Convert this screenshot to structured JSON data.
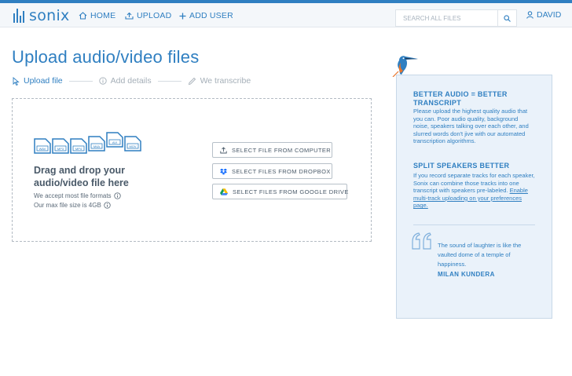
{
  "brand": {
    "logo_text": "sonix",
    "color": "#2f7fc1"
  },
  "nav": {
    "home": "HOME",
    "upload": "UPLOAD",
    "add_user": "ADD USER",
    "search_placeholder": "SEARCH ALL FILES",
    "user": "DAVID"
  },
  "page": {
    "title": "Upload audio/video files"
  },
  "steps": [
    {
      "label": "Upload file",
      "icon": "cursor-icon",
      "active": true
    },
    {
      "label": "Add details",
      "icon": "info-icon",
      "active": false
    },
    {
      "label": "We transcribe",
      "icon": "pencil-icon",
      "active": false
    }
  ],
  "dropzone": {
    "file_types": [
      "WAV",
      "MP3",
      "MP4",
      "M4A",
      "AVI",
      "MOV"
    ],
    "title": "Drag and drop your audio/video file here",
    "formats_note": "We accept most file formats",
    "size_note": "Our max file size is 4GB"
  },
  "buttons": {
    "computer": "SELECT FILE FROM COMPUTER",
    "dropbox": "SELECT FILES FROM DROPBOX",
    "google_drive": "SELECT FILES FROM GOOGLE DRIVE"
  },
  "sidebar": {
    "tip1_title": "BETTER AUDIO = BETTER TRANSCRIPT",
    "tip1_text": "Please upload the highest quality audio that you can. Poor audio quality, background noise, speakers talking over each other, and slurred words don't jive with our automated transcription algorithms.",
    "tip2_title": "SPLIT SPEAKERS BETTER",
    "tip2_text": "If you record separate tracks for each speaker, Sonix can combine those tracks into one transcript with speakers pre-labeled.",
    "tip2_link": "Enable multi-track uploading on your preferences page.",
    "quote": "The sound of laughter is like the vaulted dome of a temple of happiness.",
    "quote_author": "MILAN KUNDERA"
  }
}
